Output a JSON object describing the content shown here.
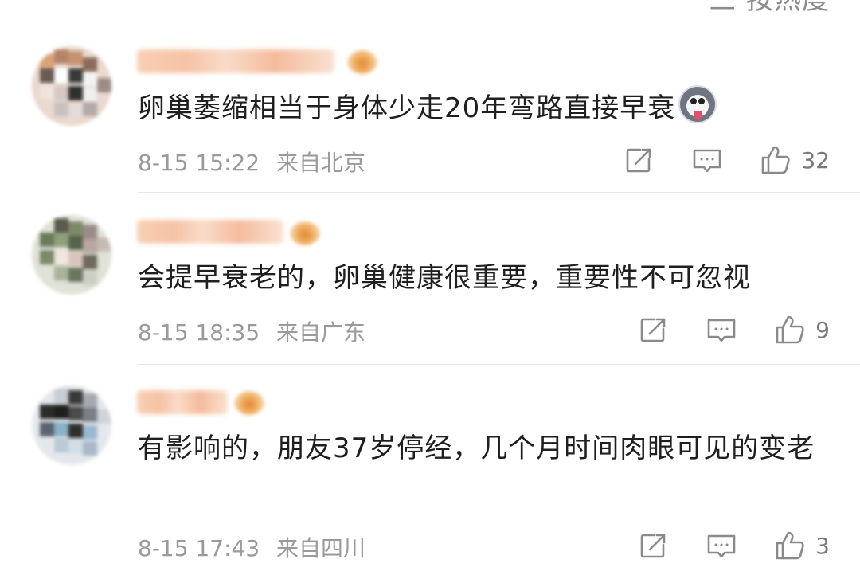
{
  "header": {
    "sort_label": "三 按热度"
  },
  "comments": [
    {
      "content": "卵巢萎缩相当于身体少走20年弯路直接早衰",
      "emoji": "husky-emoji",
      "time": "8-15 15:22",
      "location": "来自北京",
      "likes": "32"
    },
    {
      "content": "会提早衰老的，卵巢健康很重要，重要性不可忽视",
      "time": "8-15 18:35",
      "location": "来自广东",
      "likes": "9"
    },
    {
      "content": "有影响的，朋友37岁停经，几个月时间肉眼可见的变老",
      "time": "8-15 17:43",
      "location": "来自四川",
      "likes": "3"
    }
  ],
  "icons": {
    "share": "share-icon",
    "reply": "comment-icon",
    "like": "thumbs-up-icon"
  },
  "colors": {
    "text": "#1f1f1f",
    "meta": "#9a9a9a",
    "icon": "#8a8a8a",
    "divider": "#e6e6e6"
  }
}
